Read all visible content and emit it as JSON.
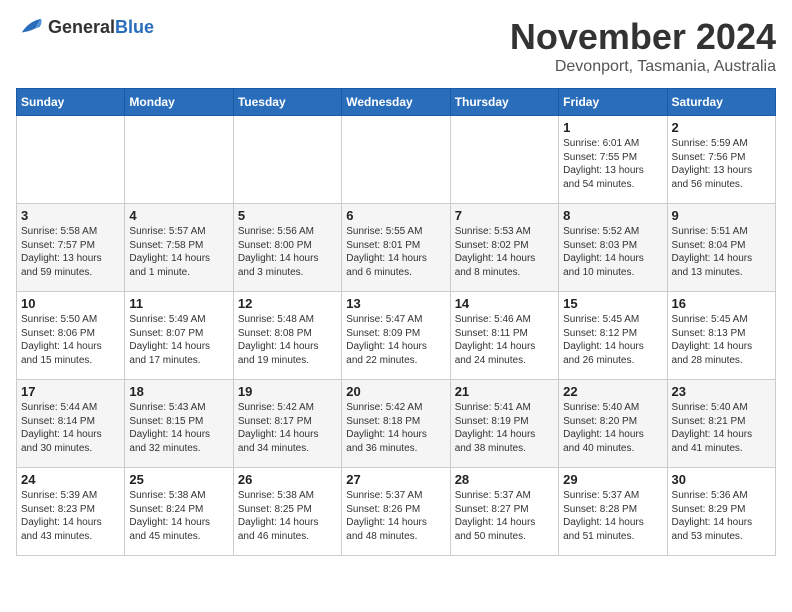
{
  "header": {
    "logo_general": "General",
    "logo_blue": "Blue",
    "month": "November 2024",
    "location": "Devonport, Tasmania, Australia"
  },
  "weekdays": [
    "Sunday",
    "Monday",
    "Tuesday",
    "Wednesday",
    "Thursday",
    "Friday",
    "Saturday"
  ],
  "weeks": [
    [
      {
        "day": "",
        "info": ""
      },
      {
        "day": "",
        "info": ""
      },
      {
        "day": "",
        "info": ""
      },
      {
        "day": "",
        "info": ""
      },
      {
        "day": "",
        "info": ""
      },
      {
        "day": "1",
        "info": "Sunrise: 6:01 AM\nSunset: 7:55 PM\nDaylight: 13 hours\nand 54 minutes."
      },
      {
        "day": "2",
        "info": "Sunrise: 5:59 AM\nSunset: 7:56 PM\nDaylight: 13 hours\nand 56 minutes."
      }
    ],
    [
      {
        "day": "3",
        "info": "Sunrise: 5:58 AM\nSunset: 7:57 PM\nDaylight: 13 hours\nand 59 minutes."
      },
      {
        "day": "4",
        "info": "Sunrise: 5:57 AM\nSunset: 7:58 PM\nDaylight: 14 hours\nand 1 minute."
      },
      {
        "day": "5",
        "info": "Sunrise: 5:56 AM\nSunset: 8:00 PM\nDaylight: 14 hours\nand 3 minutes."
      },
      {
        "day": "6",
        "info": "Sunrise: 5:55 AM\nSunset: 8:01 PM\nDaylight: 14 hours\nand 6 minutes."
      },
      {
        "day": "7",
        "info": "Sunrise: 5:53 AM\nSunset: 8:02 PM\nDaylight: 14 hours\nand 8 minutes."
      },
      {
        "day": "8",
        "info": "Sunrise: 5:52 AM\nSunset: 8:03 PM\nDaylight: 14 hours\nand 10 minutes."
      },
      {
        "day": "9",
        "info": "Sunrise: 5:51 AM\nSunset: 8:04 PM\nDaylight: 14 hours\nand 13 minutes."
      }
    ],
    [
      {
        "day": "10",
        "info": "Sunrise: 5:50 AM\nSunset: 8:06 PM\nDaylight: 14 hours\nand 15 minutes."
      },
      {
        "day": "11",
        "info": "Sunrise: 5:49 AM\nSunset: 8:07 PM\nDaylight: 14 hours\nand 17 minutes."
      },
      {
        "day": "12",
        "info": "Sunrise: 5:48 AM\nSunset: 8:08 PM\nDaylight: 14 hours\nand 19 minutes."
      },
      {
        "day": "13",
        "info": "Sunrise: 5:47 AM\nSunset: 8:09 PM\nDaylight: 14 hours\nand 22 minutes."
      },
      {
        "day": "14",
        "info": "Sunrise: 5:46 AM\nSunset: 8:11 PM\nDaylight: 14 hours\nand 24 minutes."
      },
      {
        "day": "15",
        "info": "Sunrise: 5:45 AM\nSunset: 8:12 PM\nDaylight: 14 hours\nand 26 minutes."
      },
      {
        "day": "16",
        "info": "Sunrise: 5:45 AM\nSunset: 8:13 PM\nDaylight: 14 hours\nand 28 minutes."
      }
    ],
    [
      {
        "day": "17",
        "info": "Sunrise: 5:44 AM\nSunset: 8:14 PM\nDaylight: 14 hours\nand 30 minutes."
      },
      {
        "day": "18",
        "info": "Sunrise: 5:43 AM\nSunset: 8:15 PM\nDaylight: 14 hours\nand 32 minutes."
      },
      {
        "day": "19",
        "info": "Sunrise: 5:42 AM\nSunset: 8:17 PM\nDaylight: 14 hours\nand 34 minutes."
      },
      {
        "day": "20",
        "info": "Sunrise: 5:42 AM\nSunset: 8:18 PM\nDaylight: 14 hours\nand 36 minutes."
      },
      {
        "day": "21",
        "info": "Sunrise: 5:41 AM\nSunset: 8:19 PM\nDaylight: 14 hours\nand 38 minutes."
      },
      {
        "day": "22",
        "info": "Sunrise: 5:40 AM\nSunset: 8:20 PM\nDaylight: 14 hours\nand 40 minutes."
      },
      {
        "day": "23",
        "info": "Sunrise: 5:40 AM\nSunset: 8:21 PM\nDaylight: 14 hours\nand 41 minutes."
      }
    ],
    [
      {
        "day": "24",
        "info": "Sunrise: 5:39 AM\nSunset: 8:23 PM\nDaylight: 14 hours\nand 43 minutes."
      },
      {
        "day": "25",
        "info": "Sunrise: 5:38 AM\nSunset: 8:24 PM\nDaylight: 14 hours\nand 45 minutes."
      },
      {
        "day": "26",
        "info": "Sunrise: 5:38 AM\nSunset: 8:25 PM\nDaylight: 14 hours\nand 46 minutes."
      },
      {
        "day": "27",
        "info": "Sunrise: 5:37 AM\nSunset: 8:26 PM\nDaylight: 14 hours\nand 48 minutes."
      },
      {
        "day": "28",
        "info": "Sunrise: 5:37 AM\nSunset: 8:27 PM\nDaylight: 14 hours\nand 50 minutes."
      },
      {
        "day": "29",
        "info": "Sunrise: 5:37 AM\nSunset: 8:28 PM\nDaylight: 14 hours\nand 51 minutes."
      },
      {
        "day": "30",
        "info": "Sunrise: 5:36 AM\nSunset: 8:29 PM\nDaylight: 14 hours\nand 53 minutes."
      }
    ]
  ]
}
